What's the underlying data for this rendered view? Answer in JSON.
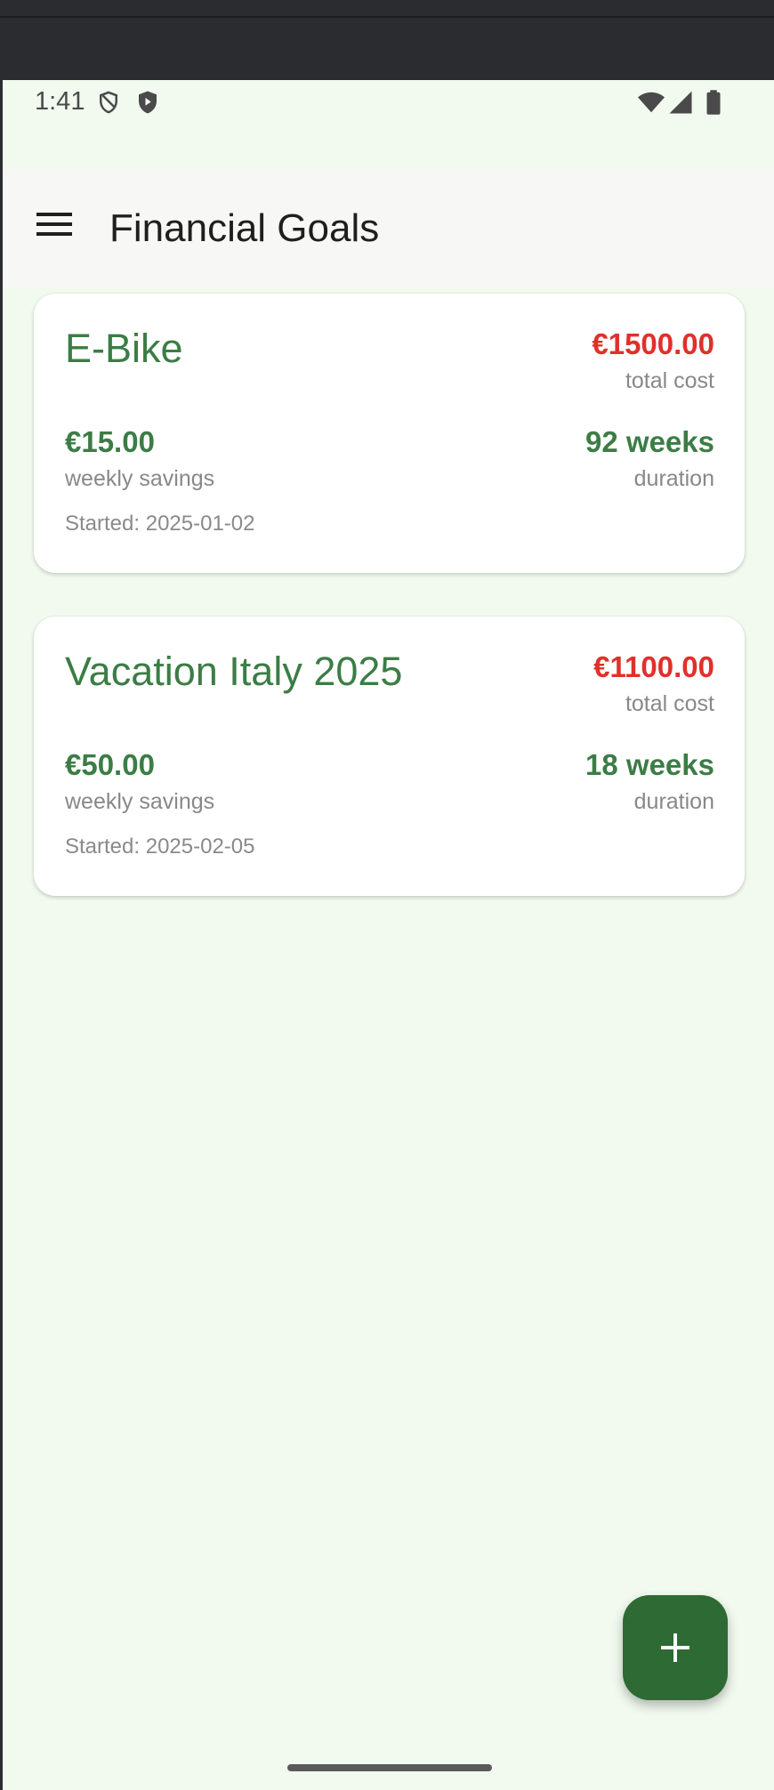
{
  "status_bar": {
    "time": "1:41",
    "icons_left": [
      "shield-outline-icon",
      "play-shield-icon"
    ],
    "icons_right": [
      "wifi-icon",
      "signal-icon",
      "battery-icon"
    ]
  },
  "app_bar": {
    "menu_icon": "hamburger-menu-icon",
    "title": "Financial Goals"
  },
  "goals": [
    {
      "name": "E-Bike",
      "total_cost": "€1500.00",
      "total_cost_label": "total cost",
      "weekly_savings": "€15.00",
      "weekly_savings_label": "weekly savings",
      "duration": "92 weeks",
      "duration_label": "duration",
      "started": "Started: 2025-01-02"
    },
    {
      "name": "Vacation Italy 2025",
      "total_cost": "€1100.00",
      "total_cost_label": "total cost",
      "weekly_savings": "€50.00",
      "weekly_savings_label": "weekly savings",
      "duration": "18 weeks",
      "duration_label": "duration",
      "started": "Started: 2025-02-05"
    }
  ],
  "fab": {
    "icon": "plus-icon"
  },
  "colors": {
    "accent_green": "#3b7d45",
    "fab_green": "#2e6a33",
    "cost_red": "#e0302a",
    "background": "#f2faf0"
  }
}
